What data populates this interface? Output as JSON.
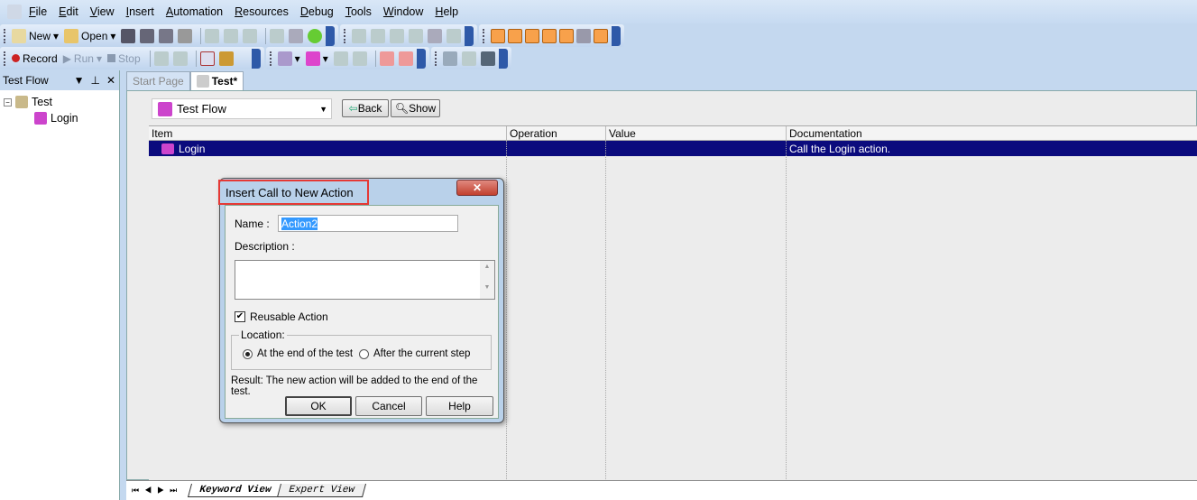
{
  "menu": [
    "File",
    "Edit",
    "View",
    "Insert",
    "Automation",
    "Resources",
    "Debug",
    "Tools",
    "Window",
    "Help"
  ],
  "toolbar": {
    "new": "New",
    "open": "Open",
    "record": "Record",
    "run": "Run",
    "stop": "Stop"
  },
  "left_panel": {
    "title": "Test Flow",
    "tree": {
      "root": "Test",
      "child": "Login"
    }
  },
  "tabs": [
    "Start Page",
    "Test*"
  ],
  "editor": {
    "view_select": "Test Flow",
    "back": "Back",
    "show": "Show",
    "columns": [
      "Item",
      "Operation",
      "Value",
      "Documentation"
    ],
    "rows": [
      {
        "item": "Login",
        "operation": "",
        "value": "",
        "documentation": "Call the Login action."
      }
    ]
  },
  "dialog": {
    "title": "Insert Call to New Action",
    "name_label": "Name :",
    "name_value": "Action2",
    "description_label": "Description :",
    "reusable_label": "Reusable Action",
    "reusable_checked": true,
    "location_label": "Location:",
    "opt_end": "At the end of the test",
    "opt_after": "After the current step",
    "selected_location": "At the end of the test",
    "result": "Result: The new action will be added to the end of the test.",
    "ok": "OK",
    "cancel": "Cancel",
    "help": "Help"
  },
  "bottom_tabs": [
    "Keyword View",
    "Expert View"
  ],
  "colors": {
    "selected_row": "#0b0b7d",
    "highlight_box": "#e53935",
    "accent_toolbar": "#f8a14b"
  }
}
